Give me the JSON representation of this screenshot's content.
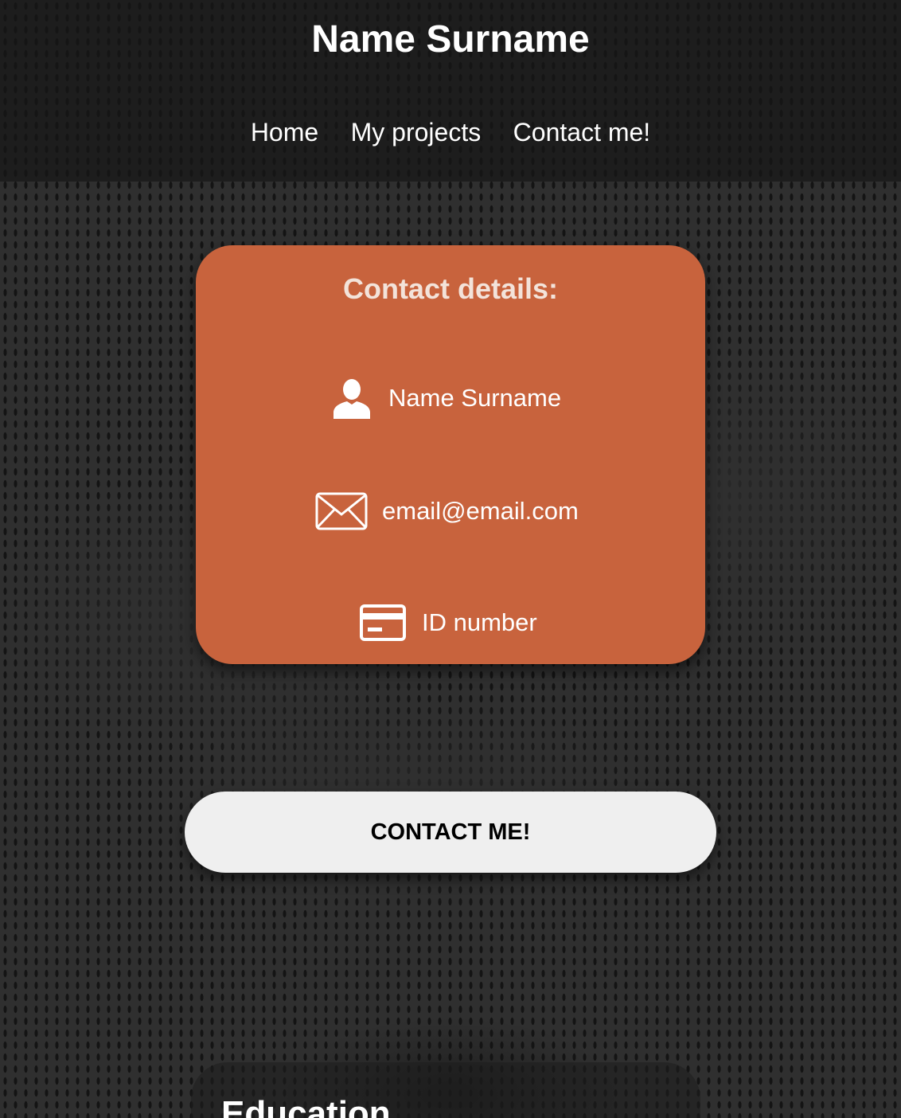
{
  "header": {
    "title": "Name Surname",
    "nav": [
      "Home",
      "My projects",
      "Contact me!"
    ]
  },
  "contact_card": {
    "title": "Contact details:",
    "name": "Name Surname",
    "email": "email@email.com",
    "id": "ID number",
    "icons": {
      "name": "user-icon",
      "email": "envelope-icon",
      "id": "id-card-icon"
    },
    "background_color": "#c8633d"
  },
  "cta": {
    "label": "CONTACT ME!"
  },
  "education": {
    "title": "Education"
  }
}
